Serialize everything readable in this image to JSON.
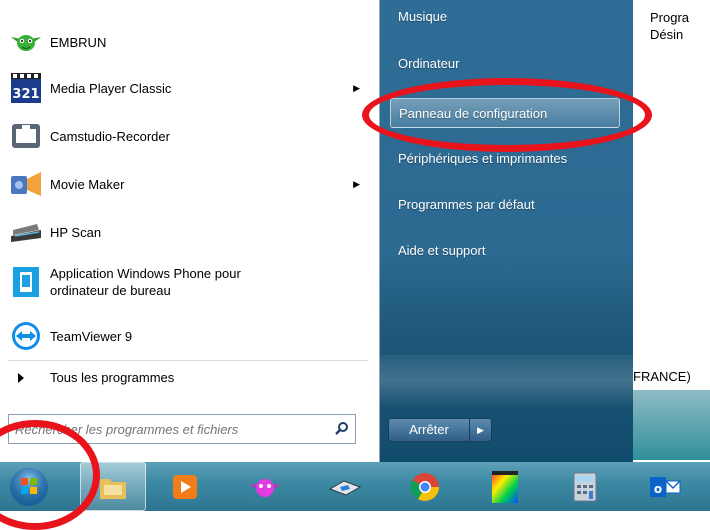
{
  "background_document": {
    "lines": [
      "Progra",
      "Désin"
    ],
    "status_fragment": "FRANCE)"
  },
  "start_menu": {
    "programs": [
      {
        "label": "EMBRUN",
        "icon": "yoda-icon",
        "has_submenu": false
      },
      {
        "label": "Media Player Classic",
        "icon": "media-player-classic-icon",
        "has_submenu": true
      },
      {
        "label": "Camstudio-Recorder",
        "icon": "camstudio-icon",
        "has_submenu": false
      },
      {
        "label": "Movie Maker",
        "icon": "movie-maker-icon",
        "has_submenu": true
      },
      {
        "label": "HP Scan",
        "icon": "hp-scan-icon",
        "has_submenu": false
      },
      {
        "label": "Application Windows Phone pour ordinateur de bureau",
        "icon": "windows-phone-icon",
        "has_submenu": false
      },
      {
        "label": "TeamViewer 9",
        "icon": "teamviewer-icon",
        "has_submenu": false
      }
    ],
    "all_programs_label": "Tous les programmes",
    "search": {
      "placeholder": "Rechercher les programmes et fichiers"
    },
    "right_items": [
      {
        "label": "Musique",
        "highlighted": false
      },
      {
        "label": "Ordinateur",
        "highlighted": false
      },
      {
        "label": "Panneau de configuration",
        "highlighted": true
      },
      {
        "label": "Périphériques et imprimantes",
        "highlighted": false
      },
      {
        "label": "Programmes par défaut",
        "highlighted": false
      },
      {
        "label": "Aide et support",
        "highlighted": false
      }
    ],
    "shutdown_label": "Arrêter"
  },
  "taskbar": {
    "items": [
      {
        "name": "start-orb"
      },
      {
        "name": "file-explorer"
      },
      {
        "name": "media-player"
      },
      {
        "name": "embrun"
      },
      {
        "name": "rhino-app"
      },
      {
        "name": "chrome"
      },
      {
        "name": "colorful-app"
      },
      {
        "name": "calculator"
      },
      {
        "name": "outlook"
      }
    ]
  },
  "colors": {
    "annotation_red": "#e8131b",
    "right_pane_blue": "#2f6d96",
    "taskbar_teal": "#3d8aa4"
  }
}
